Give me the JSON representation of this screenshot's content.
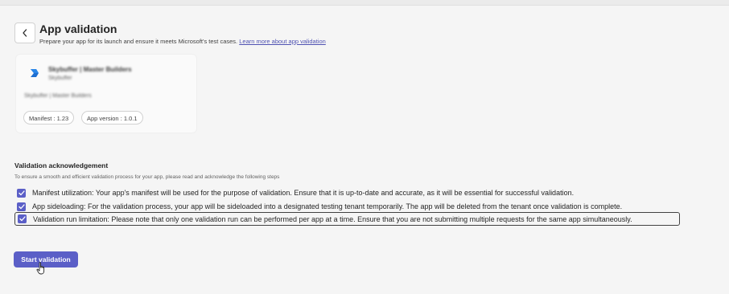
{
  "header": {
    "title": "App validation",
    "subtitle": "Prepare your app for its launch and ensure it meets Microsoft's test cases.",
    "learn_more_link": "Learn more about app validation"
  },
  "app_card": {
    "name": "Skybuffer | Master Builders",
    "developer": "Skybuffer",
    "description": "Skybuffer | Master Builders",
    "manifest_chip": "Manifest : 1.23",
    "version_chip": "App version : 1.0.1",
    "logo_color": "#1f6fd1"
  },
  "acknowledgement": {
    "title": "Validation acknowledgement",
    "description": "To ensure a smooth and efficient validation process for your app, please read and acknowledge the following steps",
    "items": [
      {
        "label": "Manifest utilization: Your app's manifest will be used for the purpose of validation. Ensure that it is up-to-date and accurate, as it will be essential for successful validation.",
        "checked": true
      },
      {
        "label": "App sideloading: For the validation process, your app will be sideloaded into a designated testing tenant temporarily. The app will be deleted from the tenant once validation is complete.",
        "checked": true
      },
      {
        "label": "Validation run limitation: Please note that only one validation run can be performed per app at a time. Ensure that you are not submitting multiple requests for the same app simultaneously.",
        "checked": true
      }
    ]
  },
  "actions": {
    "start_label": "Start validation"
  },
  "colors": {
    "accent": "#5b5fc7",
    "link": "#4f52b2",
    "background": "#f5f5f5"
  },
  "icons": {
    "back": "chevron-left-icon",
    "checkbox": "checkmark-icon",
    "cursor": "hand-pointer-cursor-icon"
  }
}
